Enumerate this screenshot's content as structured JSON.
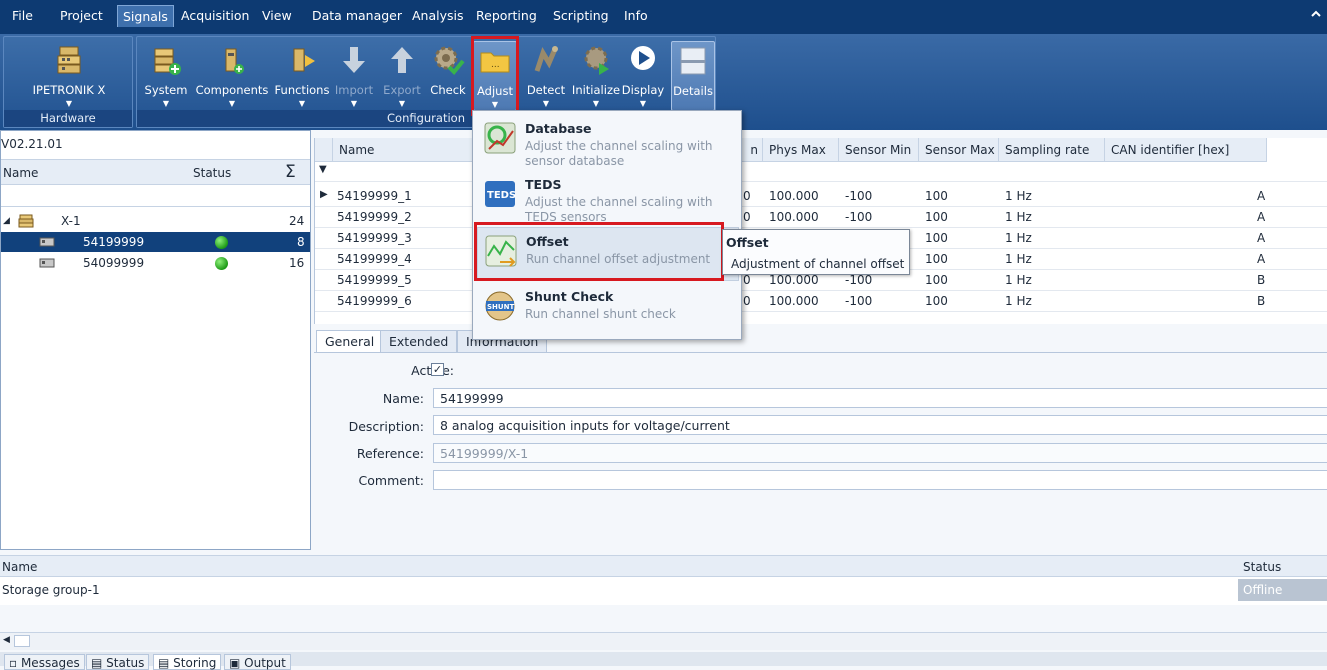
{
  "menubar": {
    "items": [
      "File",
      "Project",
      "Signals",
      "Acquisition",
      "View",
      "Data manager",
      "Analysis",
      "Reporting",
      "Scripting",
      "Info"
    ],
    "active": "Signals"
  },
  "ribbon": {
    "hardware": {
      "label": "Hardware",
      "buttons": [
        {
          "label": "IPETRONIK X",
          "icon": "module-stack-icon"
        }
      ]
    },
    "configuration": {
      "label": "Configuration",
      "buttons": [
        {
          "label": "System",
          "icon": "system-add-icon"
        },
        {
          "label": "Components",
          "icon": "components-icon"
        },
        {
          "label": "Functions",
          "icon": "functions-icon"
        },
        {
          "label": "Import",
          "icon": "arrow-down-icon",
          "disabled": true
        },
        {
          "label": "Export",
          "icon": "arrow-up-icon",
          "disabled": true
        },
        {
          "label": "Check",
          "icon": "gear-check-icon"
        },
        {
          "label": "Adjust",
          "icon": "folder-icon"
        },
        {
          "label": "Detect",
          "icon": "detect-icon"
        },
        {
          "label": "Initialize",
          "icon": "gear-play-icon"
        },
        {
          "label": "Display",
          "icon": "play-circle-icon"
        },
        {
          "label": "Details",
          "icon": "details-panel-icon"
        }
      ]
    }
  },
  "left_panel": {
    "version": "V02.21.01",
    "headers": {
      "name": "Name",
      "status": "Status",
      "sum": "Σ"
    },
    "tree": [
      {
        "name": "X-1",
        "count": "24",
        "level": 0
      },
      {
        "name": "54199999",
        "count": "8",
        "level": 1,
        "selected": true,
        "status": "green"
      },
      {
        "name": "54099999",
        "count": "16",
        "level": 1,
        "status": "green"
      }
    ]
  },
  "grid": {
    "headers": {
      "name": "Name",
      "phys_min_tail": "n",
      "phys_max": "Phys Max",
      "sensor_min": "Sensor Min",
      "sensor_max": "Sensor Max",
      "sampling": "Sampling rate",
      "can": "CAN identifier [hex]"
    },
    "rows": [
      {
        "name": "54199999_1",
        "pmin": "0",
        "pmax": "100.000",
        "smin": "-100",
        "smax": "100",
        "rate": "1 Hz",
        "can": "A"
      },
      {
        "name": "54199999_2",
        "pmin": "0",
        "pmax": "100.000",
        "smin": "-100",
        "smax": "100",
        "rate": "1 Hz",
        "can": "A"
      },
      {
        "name": "54199999_3",
        "pmin": "",
        "pmax": "",
        "smin": "",
        "smax": "100",
        "rate": "1 Hz",
        "can": "A"
      },
      {
        "name": "54199999_4",
        "pmin": "",
        "pmax": "",
        "smin": "",
        "smax": "100",
        "rate": "1 Hz",
        "can": "A"
      },
      {
        "name": "54199999_5",
        "pmin": "0",
        "pmax": "100.000",
        "smin": "-100",
        "smax": "100",
        "rate": "1 Hz",
        "can": "B"
      },
      {
        "name": "54199999_6",
        "pmin": "0",
        "pmax": "100.000",
        "smin": "-100",
        "smax": "100",
        "rate": "1 Hz",
        "can": "B"
      }
    ]
  },
  "tabs": [
    "General",
    "Extended",
    "Information"
  ],
  "form": {
    "active_label": "Active:",
    "name_label": "Name:",
    "name_value": "54199999",
    "description_label": "Description:",
    "description_value": "8 analog acquisition inputs for voltage/current",
    "reference_label": "Reference:",
    "reference_value": "54199999/X-1",
    "comment_label": "Comment:",
    "comment_value": ""
  },
  "bottom": {
    "name_header": "Name",
    "status_header": "Status",
    "row_name": "Storage group-1",
    "row_status": "Offline"
  },
  "bottom_tabs": [
    "Messages",
    "Status",
    "Storing",
    "Output"
  ],
  "adjust_menu": [
    {
      "title": "Database",
      "desc": "Adjust the channel scaling with sensor database",
      "icon": "database-icon"
    },
    {
      "title": "TEDS",
      "desc": "Adjust the channel scaling with TEDS sensors",
      "icon": "teds-icon"
    },
    {
      "title": "Offset",
      "desc": "Run channel offset adjustment",
      "icon": "offset-icon"
    },
    {
      "title": "Shunt Check",
      "desc": "Run channel shunt check",
      "icon": "shunt-icon"
    }
  ],
  "tooltip": {
    "title": "Offset",
    "desc": "Adjustment of channel offset"
  }
}
